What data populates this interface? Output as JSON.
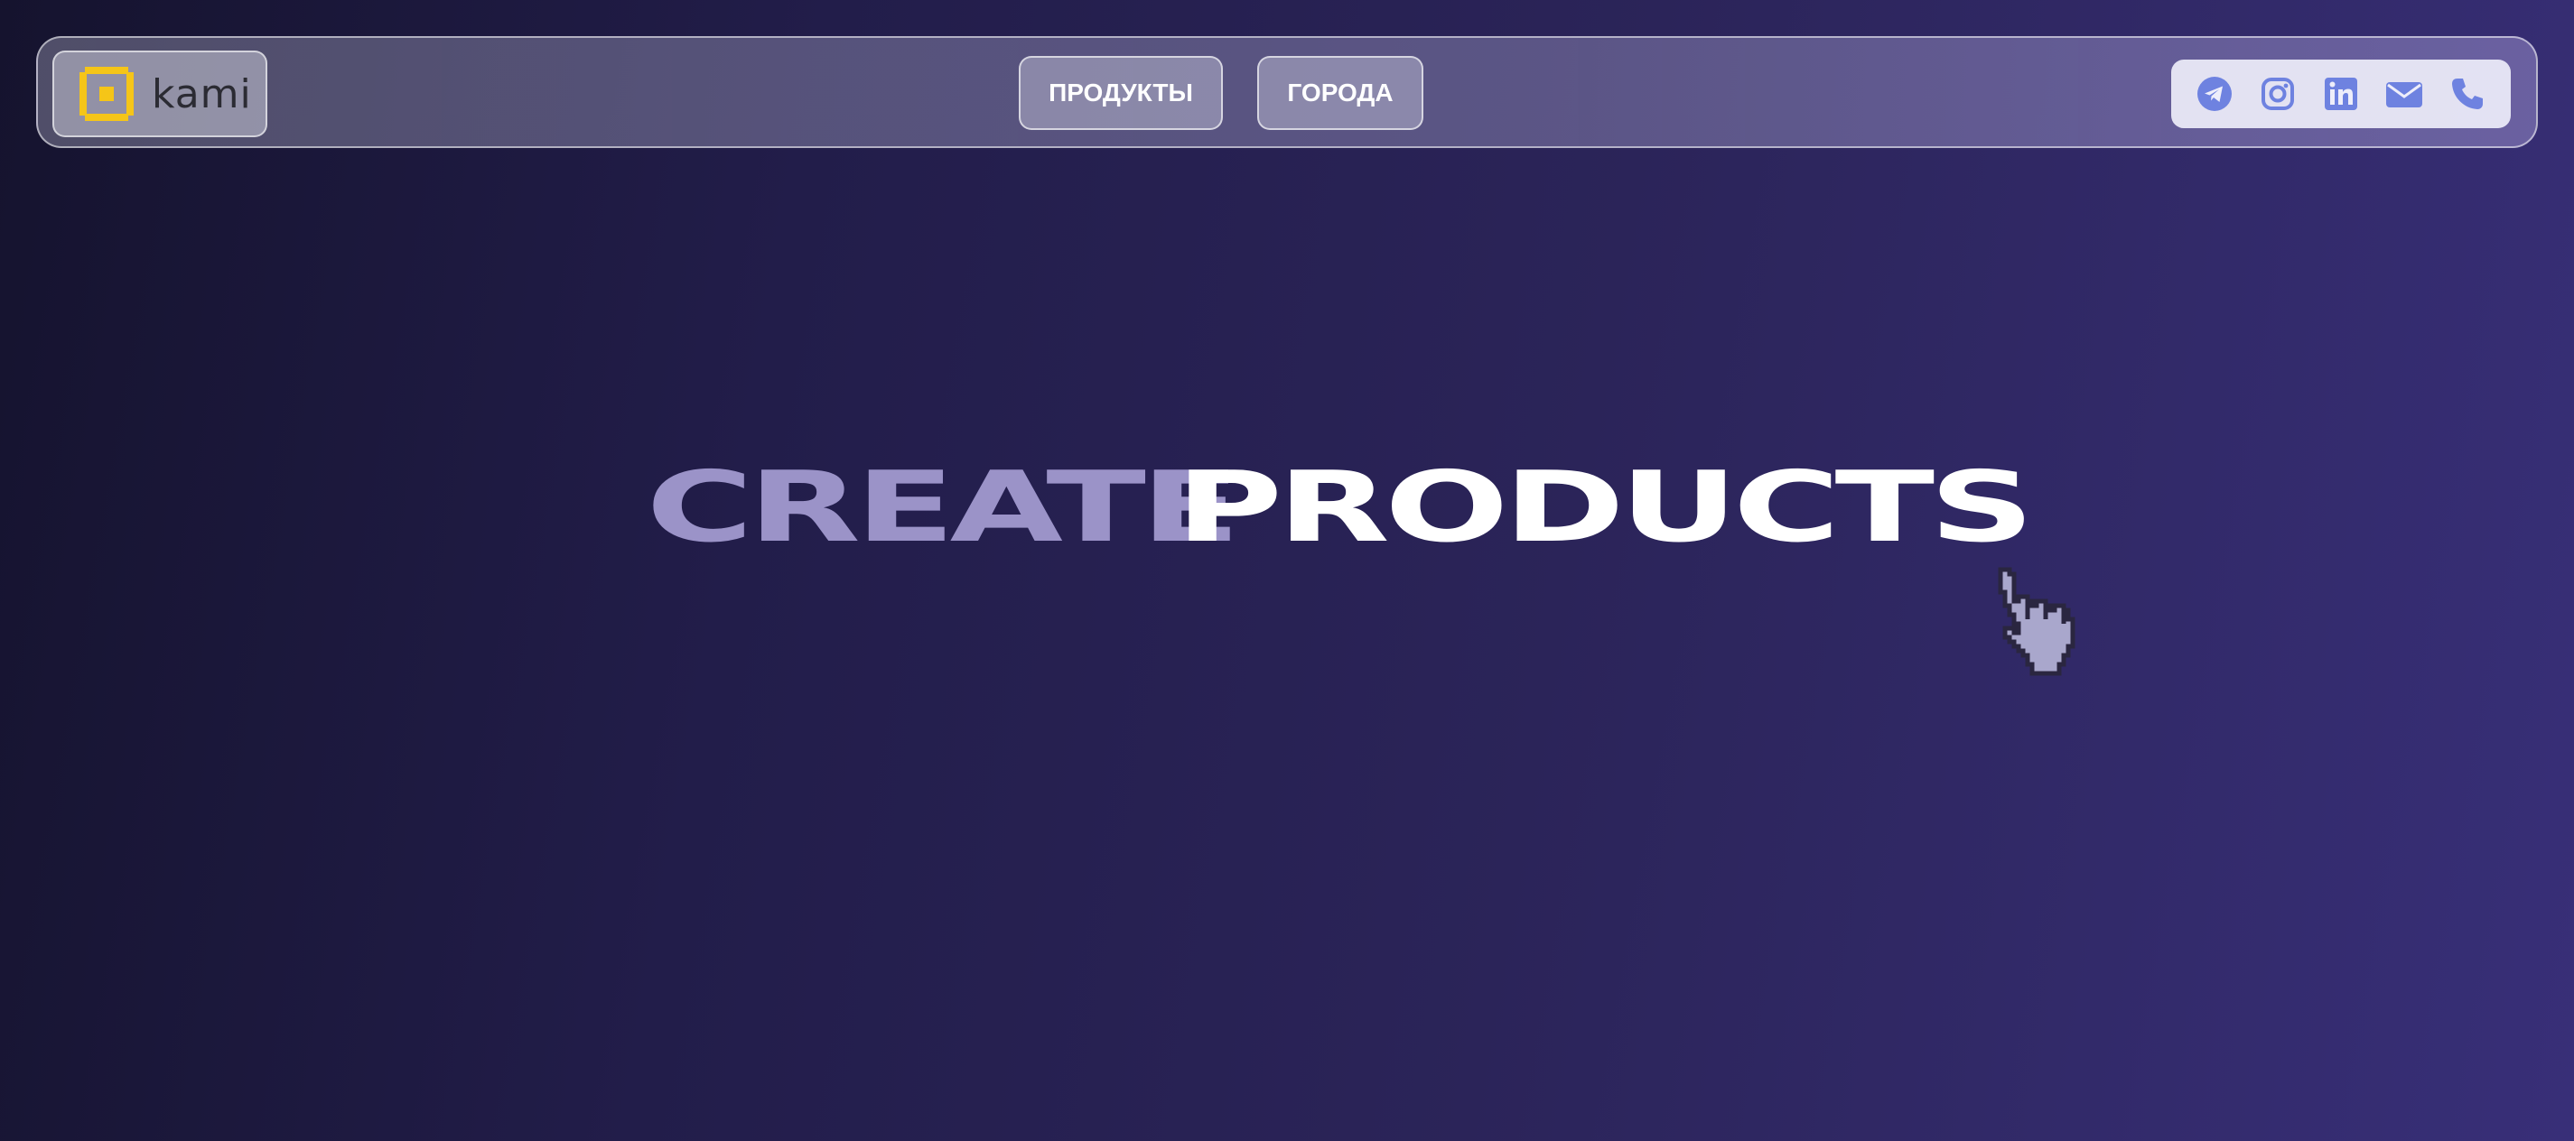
{
  "logo": {
    "text": "kami",
    "icon": "kami-square-logo-icon",
    "color": "#f5c518"
  },
  "nav": {
    "products_label": "ПРОДУКТЫ",
    "cities_label": "ГОРОДА"
  },
  "socials": {
    "icons": [
      "telegram-icon",
      "instagram-icon",
      "linkedin-icon",
      "mail-icon",
      "phone-icon"
    ],
    "color": "#6e82e0"
  },
  "hero": {
    "word1": "CREATE",
    "word2": "PRODUCTS",
    "word1_color": "#9b93c8",
    "word2_color": "#ffffff"
  },
  "cursor": {
    "icon": "pixel-hand-pointer-icon"
  }
}
